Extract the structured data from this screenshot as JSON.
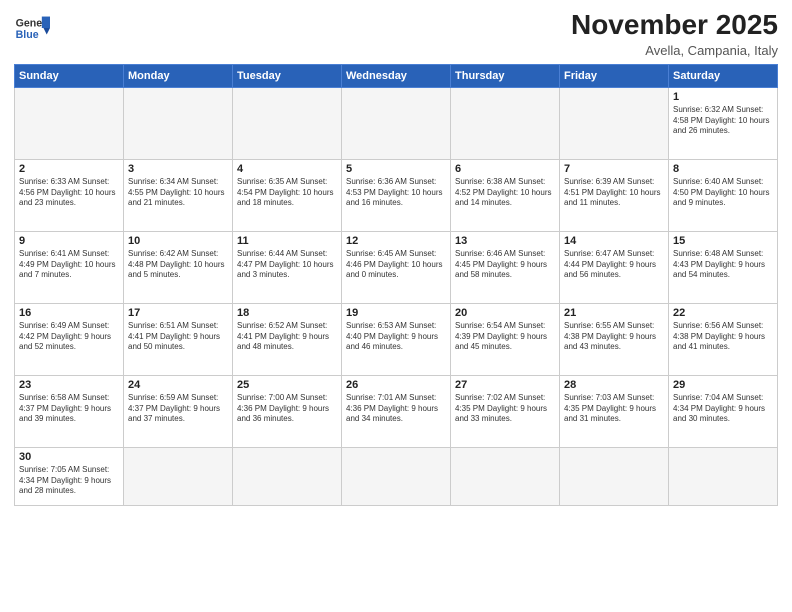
{
  "header": {
    "logo_general": "General",
    "logo_blue": "Blue",
    "month_title": "November 2025",
    "subtitle": "Avella, Campania, Italy"
  },
  "days_of_week": [
    "Sunday",
    "Monday",
    "Tuesday",
    "Wednesday",
    "Thursday",
    "Friday",
    "Saturday"
  ],
  "weeks": [
    [
      {
        "day": "",
        "info": ""
      },
      {
        "day": "",
        "info": ""
      },
      {
        "day": "",
        "info": ""
      },
      {
        "day": "",
        "info": ""
      },
      {
        "day": "",
        "info": ""
      },
      {
        "day": "",
        "info": ""
      },
      {
        "day": "1",
        "info": "Sunrise: 6:32 AM\nSunset: 4:58 PM\nDaylight: 10 hours and 26 minutes."
      }
    ],
    [
      {
        "day": "2",
        "info": "Sunrise: 6:33 AM\nSunset: 4:56 PM\nDaylight: 10 hours and 23 minutes."
      },
      {
        "day": "3",
        "info": "Sunrise: 6:34 AM\nSunset: 4:55 PM\nDaylight: 10 hours and 21 minutes."
      },
      {
        "day": "4",
        "info": "Sunrise: 6:35 AM\nSunset: 4:54 PM\nDaylight: 10 hours and 18 minutes."
      },
      {
        "day": "5",
        "info": "Sunrise: 6:36 AM\nSunset: 4:53 PM\nDaylight: 10 hours and 16 minutes."
      },
      {
        "day": "6",
        "info": "Sunrise: 6:38 AM\nSunset: 4:52 PM\nDaylight: 10 hours and 14 minutes."
      },
      {
        "day": "7",
        "info": "Sunrise: 6:39 AM\nSunset: 4:51 PM\nDaylight: 10 hours and 11 minutes."
      },
      {
        "day": "8",
        "info": "Sunrise: 6:40 AM\nSunset: 4:50 PM\nDaylight: 10 hours and 9 minutes."
      }
    ],
    [
      {
        "day": "9",
        "info": "Sunrise: 6:41 AM\nSunset: 4:49 PM\nDaylight: 10 hours and 7 minutes."
      },
      {
        "day": "10",
        "info": "Sunrise: 6:42 AM\nSunset: 4:48 PM\nDaylight: 10 hours and 5 minutes."
      },
      {
        "day": "11",
        "info": "Sunrise: 6:44 AM\nSunset: 4:47 PM\nDaylight: 10 hours and 3 minutes."
      },
      {
        "day": "12",
        "info": "Sunrise: 6:45 AM\nSunset: 4:46 PM\nDaylight: 10 hours and 0 minutes."
      },
      {
        "day": "13",
        "info": "Sunrise: 6:46 AM\nSunset: 4:45 PM\nDaylight: 9 hours and 58 minutes."
      },
      {
        "day": "14",
        "info": "Sunrise: 6:47 AM\nSunset: 4:44 PM\nDaylight: 9 hours and 56 minutes."
      },
      {
        "day": "15",
        "info": "Sunrise: 6:48 AM\nSunset: 4:43 PM\nDaylight: 9 hours and 54 minutes."
      }
    ],
    [
      {
        "day": "16",
        "info": "Sunrise: 6:49 AM\nSunset: 4:42 PM\nDaylight: 9 hours and 52 minutes."
      },
      {
        "day": "17",
        "info": "Sunrise: 6:51 AM\nSunset: 4:41 PM\nDaylight: 9 hours and 50 minutes."
      },
      {
        "day": "18",
        "info": "Sunrise: 6:52 AM\nSunset: 4:41 PM\nDaylight: 9 hours and 48 minutes."
      },
      {
        "day": "19",
        "info": "Sunrise: 6:53 AM\nSunset: 4:40 PM\nDaylight: 9 hours and 46 minutes."
      },
      {
        "day": "20",
        "info": "Sunrise: 6:54 AM\nSunset: 4:39 PM\nDaylight: 9 hours and 45 minutes."
      },
      {
        "day": "21",
        "info": "Sunrise: 6:55 AM\nSunset: 4:38 PM\nDaylight: 9 hours and 43 minutes."
      },
      {
        "day": "22",
        "info": "Sunrise: 6:56 AM\nSunset: 4:38 PM\nDaylight: 9 hours and 41 minutes."
      }
    ],
    [
      {
        "day": "23",
        "info": "Sunrise: 6:58 AM\nSunset: 4:37 PM\nDaylight: 9 hours and 39 minutes."
      },
      {
        "day": "24",
        "info": "Sunrise: 6:59 AM\nSunset: 4:37 PM\nDaylight: 9 hours and 37 minutes."
      },
      {
        "day": "25",
        "info": "Sunrise: 7:00 AM\nSunset: 4:36 PM\nDaylight: 9 hours and 36 minutes."
      },
      {
        "day": "26",
        "info": "Sunrise: 7:01 AM\nSunset: 4:36 PM\nDaylight: 9 hours and 34 minutes."
      },
      {
        "day": "27",
        "info": "Sunrise: 7:02 AM\nSunset: 4:35 PM\nDaylight: 9 hours and 33 minutes."
      },
      {
        "day": "28",
        "info": "Sunrise: 7:03 AM\nSunset: 4:35 PM\nDaylight: 9 hours and 31 minutes."
      },
      {
        "day": "29",
        "info": "Sunrise: 7:04 AM\nSunset: 4:34 PM\nDaylight: 9 hours and 30 minutes."
      }
    ],
    [
      {
        "day": "30",
        "info": "Sunrise: 7:05 AM\nSunset: 4:34 PM\nDaylight: 9 hours and 28 minutes."
      },
      {
        "day": "",
        "info": ""
      },
      {
        "day": "",
        "info": ""
      },
      {
        "day": "",
        "info": ""
      },
      {
        "day": "",
        "info": ""
      },
      {
        "day": "",
        "info": ""
      },
      {
        "day": "",
        "info": ""
      }
    ]
  ]
}
